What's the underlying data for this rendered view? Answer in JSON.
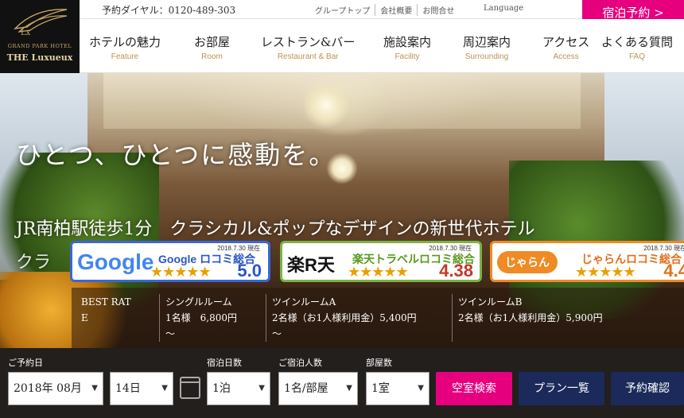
{
  "logo": {
    "subtitle": "GRAND PARK HOTEL",
    "name": "THE Luxueux",
    "mark": "Lx"
  },
  "topbar": {
    "phone": "予約ダイヤル：0120-489-303",
    "links": [
      "グループトップ",
      "会社概要",
      "お問合せ"
    ],
    "language_label": "Language",
    "language_value": "===▼",
    "reserve_button": "宿泊予約 >"
  },
  "nav": [
    {
      "jp": "ホテルの魅力",
      "en": "Feature"
    },
    {
      "jp": "お部屋",
      "en": "Room"
    },
    {
      "jp": "レストラン&バー",
      "en": "Restaurant & Bar"
    },
    {
      "jp": "施設案内",
      "en": "Facility"
    },
    {
      "jp": "周辺案内",
      "en": "Surrounding"
    },
    {
      "jp": "アクセス",
      "en": "Access"
    },
    {
      "jp": "よくある質問",
      "en": "FAQ"
    }
  ],
  "hero": {
    "slogan": "ひとつ、ひとつに感動を。",
    "subcopy": "JR南柏駅徒歩1分　クラシカル&ポップなデザインの新世代ホテル",
    "subcopy2": "クラ"
  },
  "badges": [
    {
      "logo": "Google",
      "date": "2018.7.30 現在",
      "title": "Google ロコミ総合",
      "score": "5.0",
      "color": "#3b66d6"
    },
    {
      "logo": "楽R天",
      "date": "2018.7.30 現在",
      "title": "楽天トラベルロコミ総合",
      "score": "4.38",
      "color": "#7cb342"
    },
    {
      "logo": "じゃらん",
      "date": "2018.7.30 現在",
      "title": "じゃらんロコミ総合",
      "score": "4.4",
      "color": "#f08a24"
    }
  ],
  "rates": [
    {
      "title": "BEST RAT",
      "line2": "E"
    },
    {
      "title": "シングルルーム",
      "line2": "1名様　6,800円",
      "line3": "〜"
    },
    {
      "title": "ツインルームA",
      "line2": "2名様（お1人様利用金）5,400円",
      "line3": "〜"
    },
    {
      "title": "ツインルームB",
      "line2": "2名様（お1人様利用金）5,900円"
    }
  ],
  "booking": {
    "date_label": "ご予約日",
    "month": "2018年 08月",
    "day": "14日",
    "nights_label": "宿泊日数",
    "nights": "1泊",
    "guests_label": "ご宿泊人数",
    "guests": "1名/部屋",
    "rooms_label": "部屋数",
    "rooms": "1室",
    "search_btn": "空室検索",
    "plans_btn": "プラン一覧",
    "confirm_btn": "予約確認",
    "colors": {
      "search": "#e6007e",
      "navy": "#1b2a5a"
    }
  }
}
